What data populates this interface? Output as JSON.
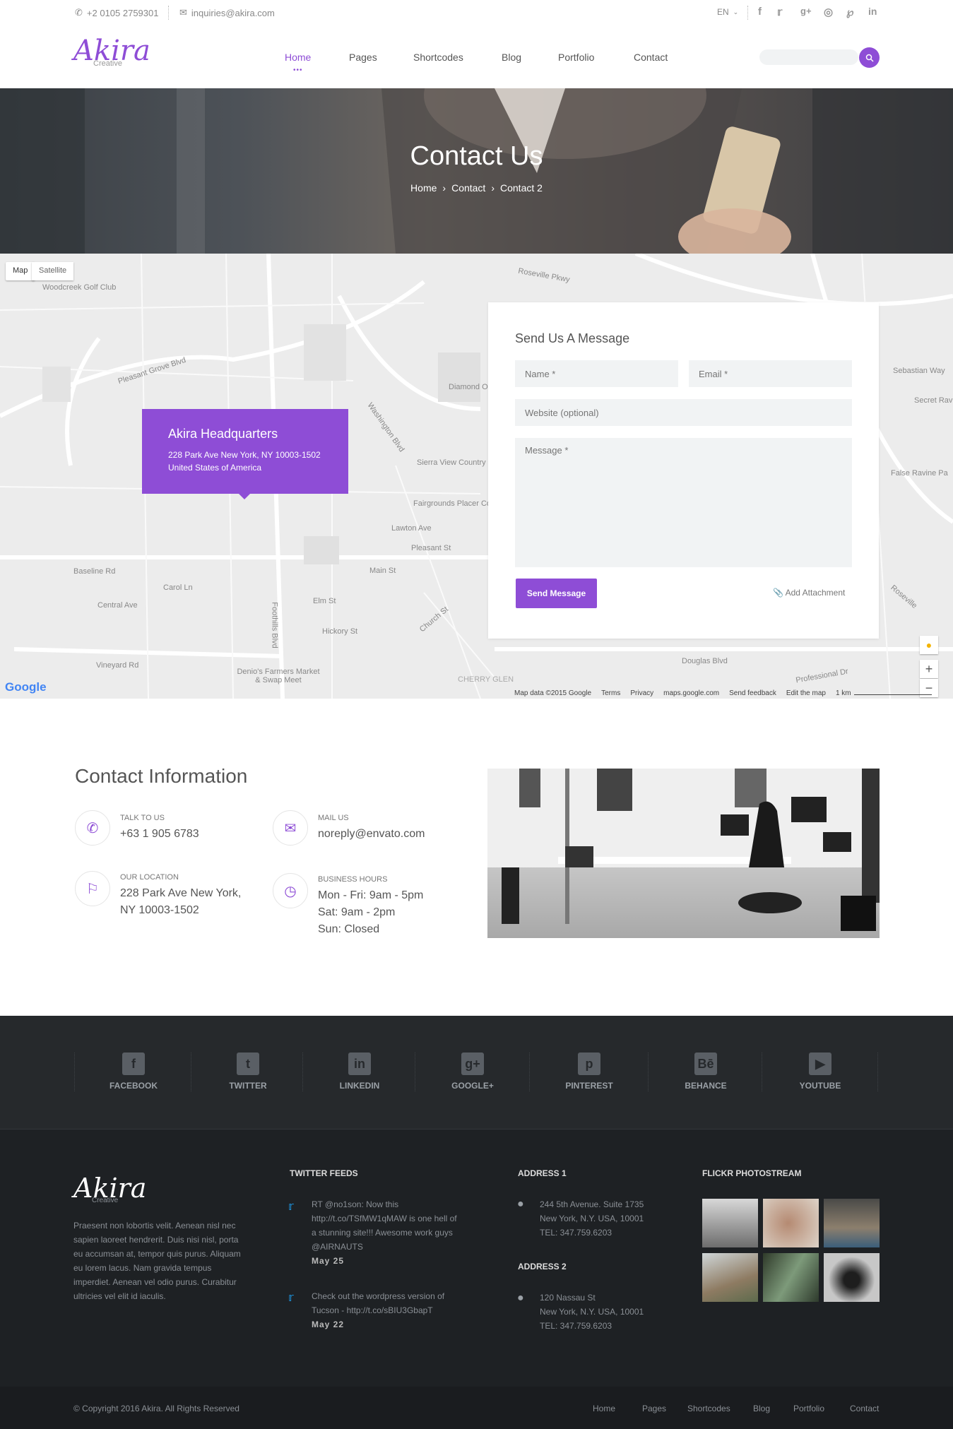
{
  "topbar": {
    "phone": "+2 0105 2759301",
    "email": "inquiries@akira.com",
    "language": "EN",
    "social_icons": [
      "facebook-icon",
      "twitter-icon",
      "google-plus-icon",
      "dribbble-icon",
      "pinterest-icon",
      "linkedin-icon"
    ]
  },
  "header": {
    "logo": "Akira",
    "logo_sub": "Creative",
    "nav": [
      "Home",
      "Pages",
      "Shortcodes",
      "Blog",
      "Portfolio",
      "Contact"
    ],
    "active_nav": "Home",
    "search_placeholder": ""
  },
  "hero": {
    "title": "Contact Us",
    "breadcrumb": [
      "Home",
      "Contact",
      "Contact 2"
    ]
  },
  "map": {
    "tabs": [
      "Map",
      "Satellite"
    ],
    "labels": [
      "Woodcreek Golf Club",
      "Pleasant Grove Blvd",
      "Roseville Pkwy",
      "Diamond Oaks Rd",
      "Washington Blvd",
      "Sierra View Country",
      "Fairgrounds Placer County",
      "Lawton Ave",
      "Pleasant St",
      "Main St",
      "Baseline Rd",
      "Carol Ln",
      "Central Ave",
      "Elm St",
      "Vineyard Rd",
      "Denio's Farmers Market & Swap Meet",
      "Douglas Blvd",
      "CHERRY GLEN",
      "Sebastian Way",
      "Secret Rav",
      "False Ravine Pa",
      "Roseville",
      "Foothills Blvd",
      "Hickory St",
      "Church St",
      "Professional Dr"
    ],
    "footer": [
      "Map data ©2015 Google",
      "Terms",
      "Privacy",
      "maps.google.com",
      "Send feedback",
      "Edit the map",
      "1 km"
    ],
    "google": "Google",
    "zoom_in": "+",
    "zoom_out": "−"
  },
  "hq": {
    "title": "Akira Headquarters",
    "address1": "228 Park Ave New York, NY 10003-1502",
    "address2": "United States of America"
  },
  "form": {
    "title": "Send Us A Message",
    "name_placeholder": "Name *",
    "email_placeholder": "Email *",
    "website_placeholder": "Website (optional)",
    "message_placeholder": "Message *",
    "send_label": "Send Message",
    "attach_label": "Add Attachment"
  },
  "contact_info": {
    "title": "Contact Information",
    "items": [
      {
        "label": "TALK TO US",
        "value": "+63 1 905 6783",
        "icon": "phone-icon"
      },
      {
        "label": "MAIL US",
        "value": "noreply@envato.com",
        "icon": "mail-icon"
      },
      {
        "label": "OUR LOCATION",
        "value": "228 Park Ave New York,\nNY 10003-1502",
        "icon": "map-icon"
      },
      {
        "label": "BUSINESS HOURS",
        "value": "Mon - Fri: 9am - 5pm\nSat: 9am - 2pm\nSun: Closed",
        "icon": "clock-icon"
      }
    ]
  },
  "footer_social": [
    "FACEBOOK",
    "TWITTER",
    "LINKEDIN",
    "GOOGLE+",
    "PINTEREST",
    "BEHANCE",
    "YOUTUBE"
  ],
  "footer": {
    "logo": "Akira",
    "logo_sub": "Creative",
    "about": "Praesent non lobortis velit. Aenean nisl nec sapien laoreet hendrerit. Duis nisi nisl, porta eu accumsan at, tempor quis purus. Aliquam eu lorem lacus. Nam gravida tempus imperdiet. Aenean vel odio purus. Curabitur ultricies vel elit id iaculis.",
    "twitter_title": "TWITTER FEEDS",
    "tweets": [
      {
        "text": "RT @no1son: Now this http://t.co/TSfMW1qMAW is one hell of a stunning site!!! Awesome work guys @AIRNAUTS",
        "date": "May 25"
      },
      {
        "text": "Check out the wordpress version of Tucson - http://t.co/sBIU3GbapT",
        "date": "May 22"
      }
    ],
    "address1_title": "ADDRESS 1",
    "address1": [
      "244 5th Avenue. Suite 1735",
      "New York, N.Y. USA, 10001",
      "TEL: 347.759.6203"
    ],
    "address2_title": "ADDRESS 2",
    "address2": [
      "120 Nassau St",
      "New York, N.Y. USA, 10001",
      "TEL: 347.759.6203"
    ],
    "flickr_title": "FLICKR PHOTOSTREAM"
  },
  "bottom": {
    "copyright": "© Copyright 2016 Akira. All Rights Reserved",
    "links": [
      "Home",
      "Pages",
      "Shortcodes",
      "Blog",
      "Portfolio",
      "Contact"
    ]
  }
}
